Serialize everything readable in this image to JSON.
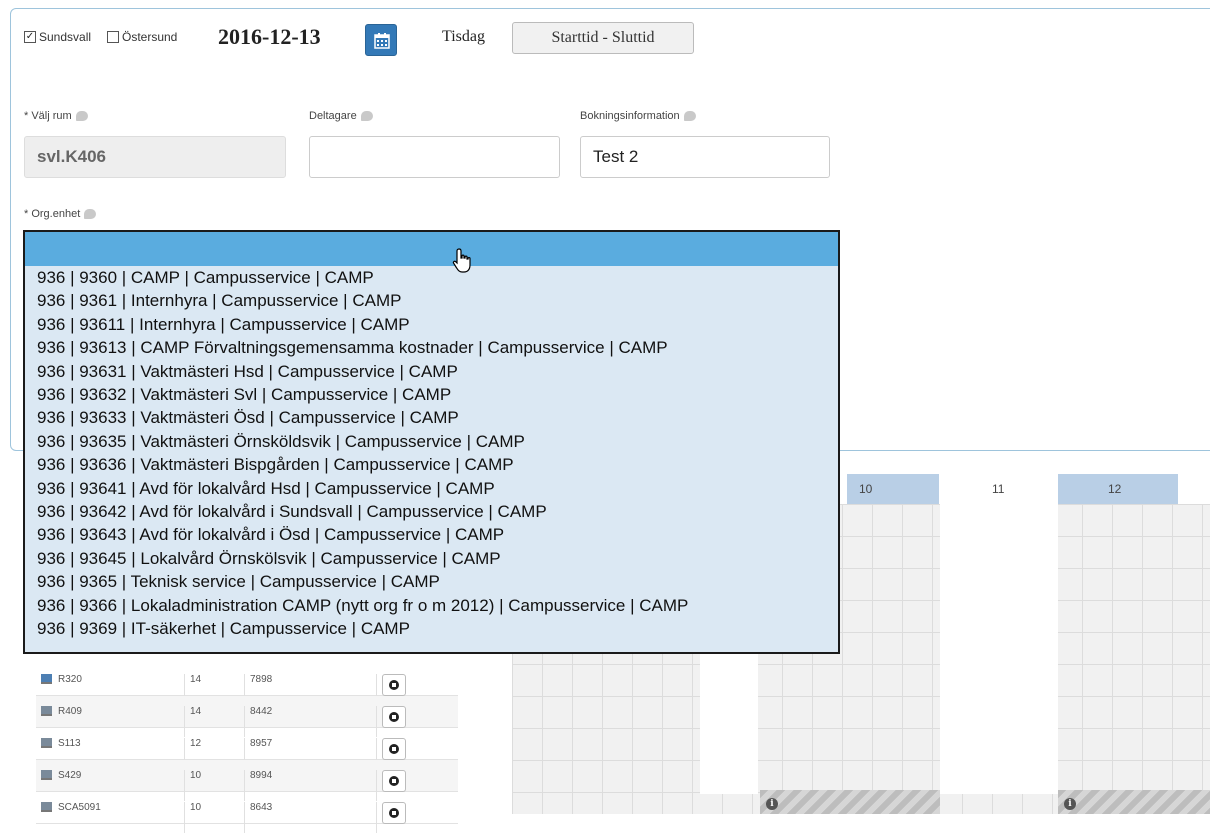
{
  "header": {
    "location_sundsvall": "Sundsvall",
    "location_ostersund": "Östersund",
    "sundsvall_checked": true,
    "ostersund_checked": false,
    "date": "2016-12-13",
    "weekday": "Tisdag",
    "time_button": "Starttid - Sluttid"
  },
  "form": {
    "room_label": "* Välj rum",
    "room_value": "svl.K406",
    "participants_label": "Deltagare",
    "participants_value": "",
    "booking_info_label": "Bokningsinformation",
    "booking_info_value": "Test 2",
    "org_label": "* Org.enhet"
  },
  "org_dropdown": {
    "selected": "",
    "options": [
      "936 | 9360 | CAMP | Campusservice | CAMP",
      "936 | 9361 | Internhyra | Campusservice | CAMP",
      "936 | 93611 | Internhyra | Campusservice | CAMP",
      "936 | 93613 | CAMP Förvaltningsgemensamma kostnader | Campusservice | CAMP",
      "936 | 93631 | Vaktmästeri Hsd | Campusservice | CAMP",
      "936 | 93632 | Vaktmästeri Svl | Campusservice | CAMP",
      "936 | 93633 | Vaktmästeri Ösd | Campusservice | CAMP",
      "936 | 93635 | Vaktmästeri Örnsköldsvik | Campusservice | CAMP",
      "936 | 93636 | Vaktmästeri Bispgården | Campusservice | CAMP",
      "936 | 93641 | Avd för lokalvård Hsd | Campusservice | CAMP",
      "936 | 93642 | Avd för lokalvård i Sundsvall | Campusservice | CAMP",
      "936 | 93643 | Avd för lokalvård i Ösd | Campusservice | CAMP",
      "936 | 93645 | Lokalvård Örnskölsvik | Campusservice | CAMP",
      "936 | 9365 | Teknisk service | Campusservice | CAMP",
      "936 | 9366 | Lokaladministration CAMP (nytt org fr o m 2012) | Campusservice | CAMP",
      "936 | 9369 | IT-säkerhet | Campusservice | CAMP"
    ]
  },
  "schedule": {
    "hours": [
      "10",
      "11",
      "12"
    ],
    "rooms": [
      {
        "name": "R320",
        "seats": "14",
        "code": "7898"
      },
      {
        "name": "R409",
        "seats": "14",
        "code": "8442"
      },
      {
        "name": "S113",
        "seats": "12",
        "code": "8957"
      },
      {
        "name": "S429",
        "seats": "10",
        "code": "8994"
      },
      {
        "name": "SCA5091",
        "seats": "10",
        "code": "8643"
      }
    ]
  },
  "colors": {
    "primary_button": "#3379b7",
    "dropdown_bg": "#dbe8f3",
    "dropdown_selected": "#5aacdf",
    "hour_header_blue": "#b9cfe6"
  }
}
